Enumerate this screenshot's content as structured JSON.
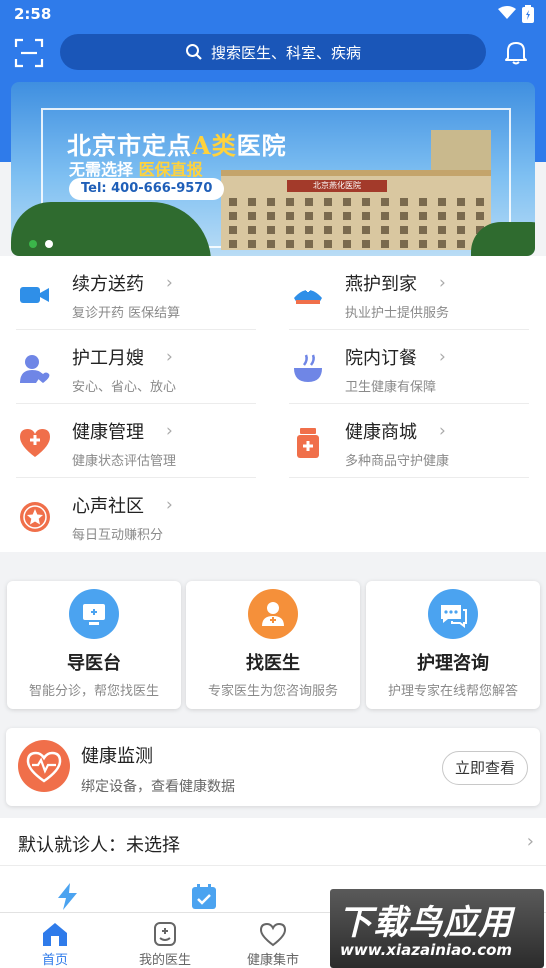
{
  "status_bar": {
    "time": "2:58"
  },
  "search": {
    "placeholder": "搜索医生、科室、疾病"
  },
  "banner": {
    "title_part1": "北京市定点",
    "title_highlight": "A类",
    "title_part2": "医院",
    "sub_part1": "无需选择",
    "sub_highlight": "医保直报",
    "tel": "Tel: 400-666-9570",
    "building_sign": "北京燕化医院",
    "colors": {
      "active_dot": "#3bb54a",
      "inactive_dot": "#ffffff"
    }
  },
  "services": [
    {
      "name": "续方送药",
      "desc": "复诊开药 医保结算",
      "icon": "video-camera-icon"
    },
    {
      "name": "燕护到家",
      "desc": "执业护士提供服务",
      "icon": "nurse-cap-icon"
    },
    {
      "name": "护工月嫂",
      "desc": "安心、省心、放心",
      "icon": "caregiver-icon"
    },
    {
      "name": "院内订餐",
      "desc": "卫生健康有保障",
      "icon": "meal-bowl-icon"
    },
    {
      "name": "健康管理",
      "desc": "健康状态评估管理",
      "icon": "heart-plus-icon"
    },
    {
      "name": "健康商城",
      "desc": "多种商品守护健康",
      "icon": "medicine-bottle-icon"
    },
    {
      "name": "心声社区",
      "desc": "每日互动赚积分",
      "icon": "star-badge-icon"
    }
  ],
  "cards": [
    {
      "title": "导医台",
      "desc": "智能分诊，帮您找医生",
      "icon": "monitor-icon",
      "color": "#4ba3f0"
    },
    {
      "title": "找医生",
      "desc": "专家医生为您咨询服务",
      "icon": "doctor-icon",
      "color": "#f5903a"
    },
    {
      "title": "护理咨询",
      "desc": "护理专家在线帮您解答",
      "icon": "chat-icon",
      "color": "#4ba3f0"
    }
  ],
  "monitor": {
    "title": "健康监测",
    "desc": "绑定设备，查看健康数据",
    "button": "立即查看"
  },
  "patient": {
    "label": "默认就诊人：未选择"
  },
  "tabs": [
    {
      "label": "首页",
      "icon": "home-icon",
      "active": true
    },
    {
      "label": "我的医生",
      "icon": "my-doctor-icon",
      "active": false
    },
    {
      "label": "健康集市",
      "icon": "heart-outline-icon",
      "active": false
    }
  ],
  "watermark": {
    "main": "下载鸟应用",
    "url": "www.xiazainiao.com"
  },
  "colors": {
    "brand": "#2f7bea",
    "search_bg": "#1a56b8",
    "accent_orange": "#f06f4a"
  }
}
